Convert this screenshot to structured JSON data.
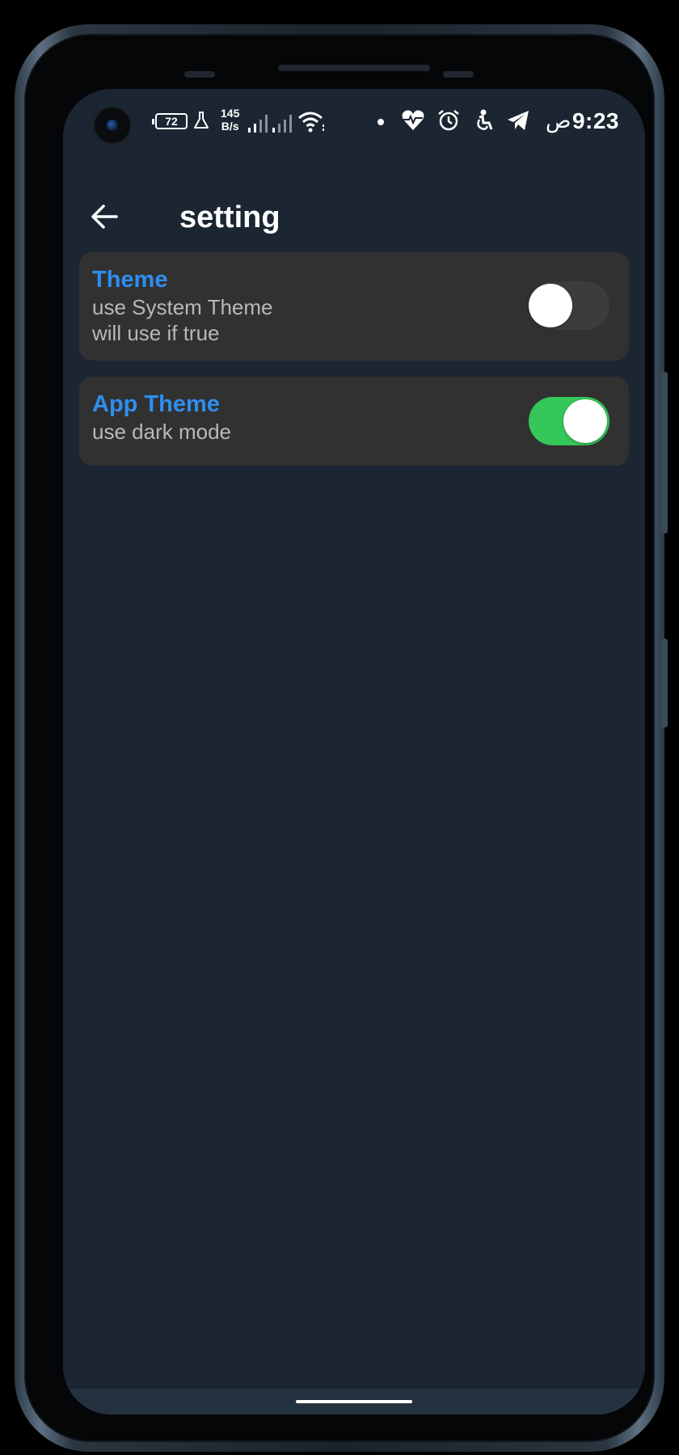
{
  "status_bar": {
    "battery_level": "72",
    "net_speed_value": "145",
    "net_speed_unit": "B/s",
    "time_suffix": "ص",
    "time": "9:23",
    "icons": [
      "camera-icon",
      "battery-icon",
      "flask-icon",
      "signal-icon",
      "signal-icon",
      "wifi-icon",
      "notification-dot-icon",
      "heart-rate-icon",
      "alarm-icon",
      "accessibility-icon",
      "telegram-icon"
    ]
  },
  "app_bar": {
    "back_icon": "arrow-back-icon",
    "title": "setting"
  },
  "settings": [
    {
      "title": "Theme",
      "subtitle": "use System Theme\nwill use if true",
      "line1": "use System Theme",
      "line2": "will use if true",
      "enabled": false
    },
    {
      "title": "App Theme",
      "subtitle": "use dark mode",
      "enabled": true
    }
  ],
  "colors": {
    "background": "#1b2632",
    "card": "#313131",
    "accent_title": "#2e8ef0",
    "switch_on": "#35c759",
    "switch_off_track": "#3c3c3c"
  }
}
